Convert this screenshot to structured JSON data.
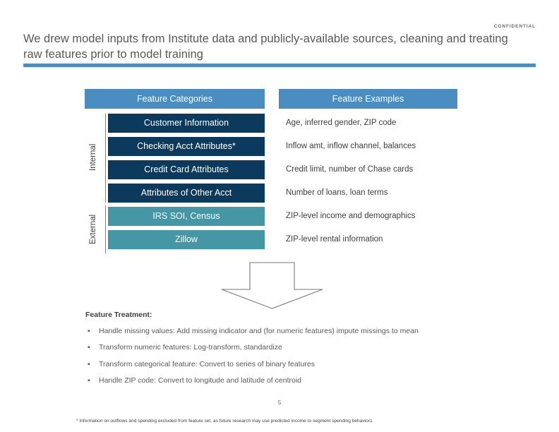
{
  "header": {
    "confidential": "CONFIDENTIAL",
    "title": "We drew model inputs from Institute data and publicly-available sources, cleaning and treating raw features prior to model training"
  },
  "colors": {
    "accent_blue": "#4a8dc0",
    "navy": "#0c3a5c",
    "teal": "#4597a5",
    "text_gray": "#404040"
  },
  "table": {
    "column_headers": {
      "categories": "Feature Categories",
      "examples": "Feature Examples"
    },
    "groups": [
      {
        "label": "Internal"
      },
      {
        "label": "External"
      }
    ],
    "rows": [
      {
        "group": "Internal",
        "category": "Customer Information",
        "example": "Age, inferred gender, ZIP code"
      },
      {
        "group": "Internal",
        "category": "Checking Acct Attributes*",
        "example": "Inflow amt, inflow channel, balances"
      },
      {
        "group": "Internal",
        "category": "Credit Card Attributes",
        "example": "Credit limit, number of Chase cards"
      },
      {
        "group": "Internal",
        "category": "Attributes of Other Acct",
        "example": "Number of loans, loan terms"
      },
      {
        "group": "External",
        "category": "IRS SOI, Census",
        "example": "ZIP-level income and demographics"
      },
      {
        "group": "External",
        "category": "Zillow",
        "example": "ZIP-level rental information"
      }
    ]
  },
  "treatment": {
    "title": "Feature Treatment:",
    "bullets": [
      "Handle missing values: Add missing indicator and (for numeric features) impute missings to mean",
      "Transform numeric features: Log-transform, standardize",
      "Transform categorical feature: Convert to series of binary features",
      "Handle ZIP code: Convert to longitude and latitude of centroid"
    ],
    "bullet_marker": "▪"
  },
  "footer": {
    "page_number": "5",
    "footnote": "* Information on outflows and spending excluded from feature set, as future research may use predicted income to segment spending behaviors"
  }
}
